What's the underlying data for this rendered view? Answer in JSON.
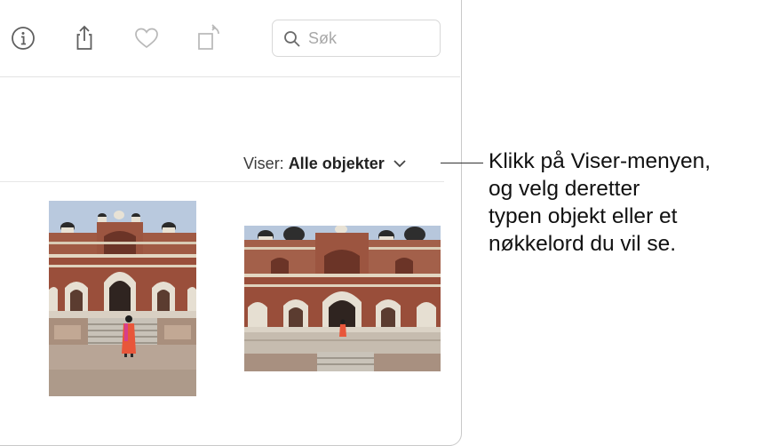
{
  "toolbar": {
    "icons": [
      "info-icon",
      "share-icon",
      "heart-icon",
      "rotate-icon"
    ],
    "search": {
      "placeholder": "Søk",
      "value": ""
    }
  },
  "filter": {
    "label": "Viser:",
    "value": "Alle objekter"
  },
  "photos": [
    {
      "name": "humayun-tomb-portrait"
    },
    {
      "name": "humayun-tomb-landscape"
    }
  ],
  "callout": {
    "lines": [
      "Klikk på Viser-menyen,",
      "og velg deretter",
      "typen objekt eller et",
      "nøkkelord du vil se."
    ]
  },
  "colors": {
    "sky": "#b7c7dc",
    "sandstone": "#9a4f3b",
    "marble": "#ece7dd",
    "ground": "#b9a594",
    "dress": "#e8563a"
  }
}
